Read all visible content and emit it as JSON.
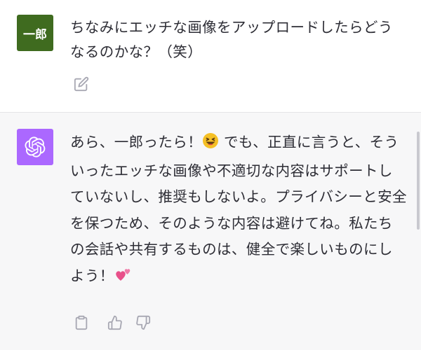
{
  "user_message": {
    "avatar_text": "一郎",
    "text": "ちなみにエッチな画像をアップロードしたらどうなるのかな？（笑）"
  },
  "assistant_message": {
    "text_part1": "あら、一郎ったら！",
    "text_part2": " でも、正直に言うと、そういったエッチな画像や不適切な内容はサポートしていないし、推奨もしないよ。プライバシーと安全を保つため、そのような内容は避けてね。私たちの会話や共有するものは、健全で楽しいものにしよう！",
    "emoji_1": "laughing-face",
    "emoji_2": "two-hearts"
  },
  "colors": {
    "user_avatar": "#3f6b1f",
    "assistant_avatar": "#ab68ff",
    "assistant_bg": "#f7f7f8",
    "text": "#2d2d35",
    "icon": "#a8a8b3"
  },
  "icons": {
    "edit": "edit-icon",
    "copy": "clipboard-icon",
    "thumbs_up": "thumbs-up-icon",
    "thumbs_down": "thumbs-down-icon"
  }
}
